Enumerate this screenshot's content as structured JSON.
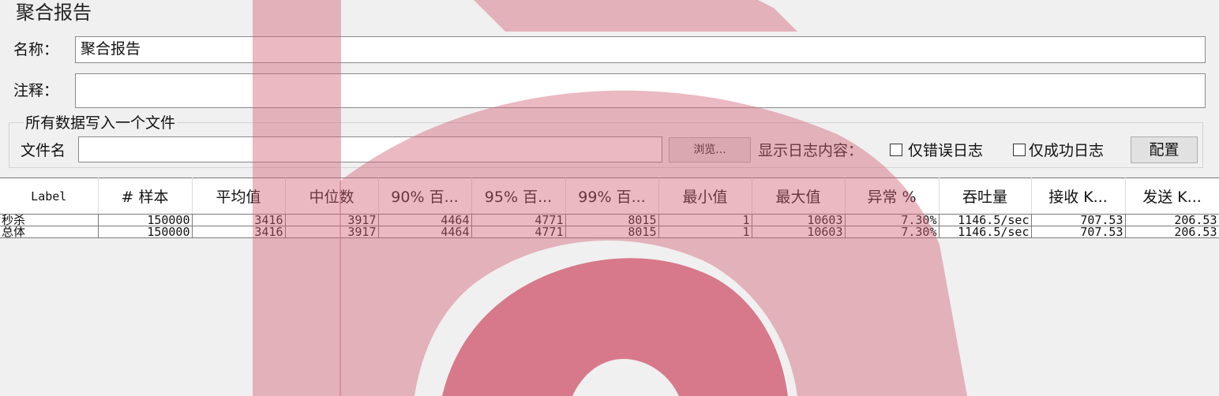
{
  "panel": {
    "title": "聚合报告",
    "name_label": "名称：",
    "name_value": "聚合报告",
    "comment_label": "注释：",
    "comment_value": ""
  },
  "file_group": {
    "title": "所有数据写入一个文件",
    "filename_label": "文件名",
    "filename_value": "",
    "browse_button": "浏览...",
    "log_label": "显示日志内容：",
    "errors_only_label": "仅错误日志",
    "errors_only_checked": false,
    "success_only_label": "仅成功日志",
    "success_only_checked": false,
    "configure_button": "配置"
  },
  "table": {
    "columns": [
      "Label",
      "# 样本",
      "平均值",
      "中位数",
      "90% 百...",
      "95% 百...",
      "99% 百...",
      "最小值",
      "最大值",
      "异常 %",
      "吞吐量",
      "接收 K...",
      "发送 K..."
    ],
    "rows": [
      [
        "秒杀",
        "150000",
        "3416",
        "3917",
        "4464",
        "4771",
        "8015",
        "1",
        "10603",
        "7.30%",
        "1146.5/sec",
        "707.53",
        "206.53"
      ],
      [
        "总体",
        "150000",
        "3416",
        "3917",
        "4464",
        "4771",
        "8015",
        "1",
        "10603",
        "7.30%",
        "1146.5/sec",
        "707.53",
        "206.53"
      ]
    ]
  },
  "colors": {
    "watermark": "#d26478",
    "background": "#f0f0f0"
  }
}
